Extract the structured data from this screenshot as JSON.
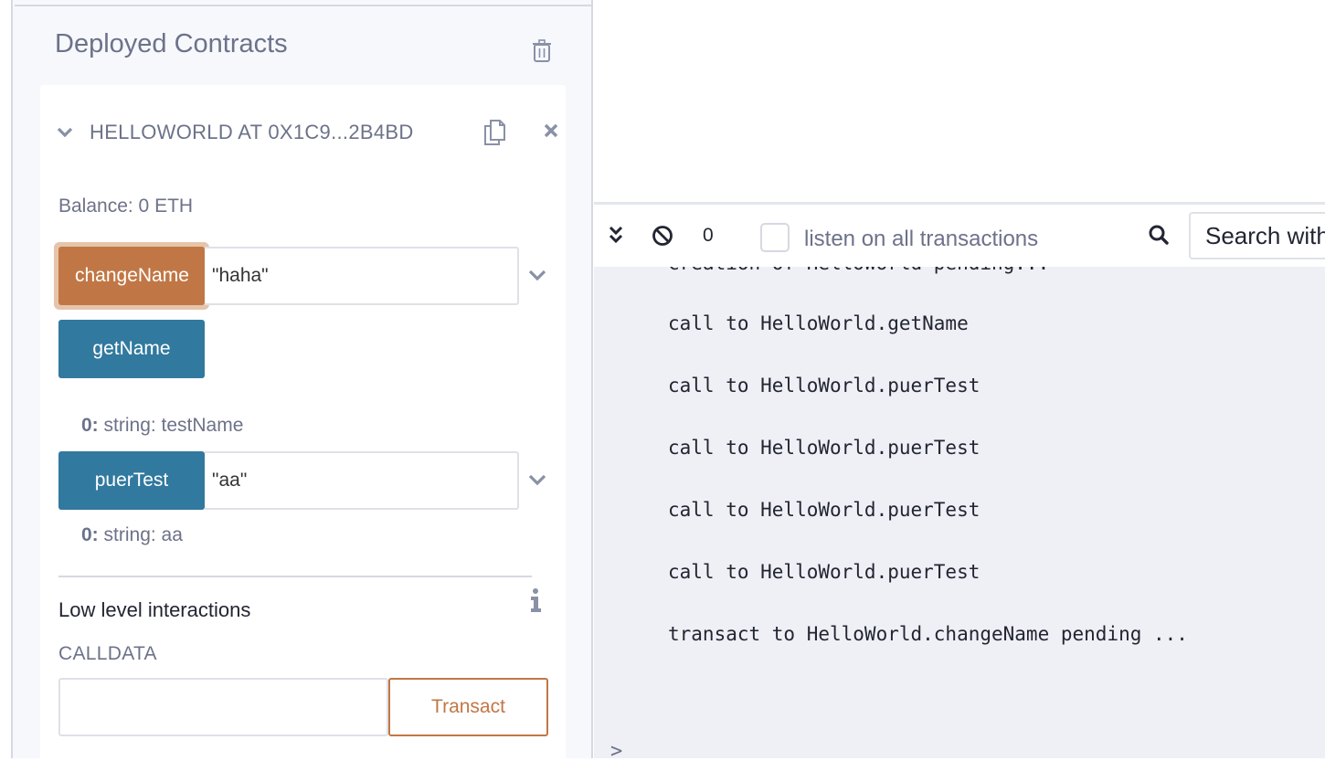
{
  "deployed": {
    "title": "Deployed Contracts",
    "contract": {
      "title": "HELLOWORLD AT 0X1C9...2B4BD",
      "balance": "Balance: 0 ETH",
      "functions": [
        {
          "label": "changeName",
          "kind": "transact",
          "input_value": "\"haha\"",
          "focused": true
        },
        {
          "label": "getName",
          "kind": "call"
        },
        {
          "label": "puerTest",
          "kind": "call",
          "input_value": "\"aa\""
        }
      ],
      "results": [
        {
          "index": "0:",
          "text": " string: testName"
        },
        {
          "index": "0:",
          "text": " string: aa"
        }
      ]
    },
    "low_level": {
      "title": "Low level interactions",
      "calldata_label": "CALLDATA",
      "calldata_value": "",
      "transact_label": "Transact"
    }
  },
  "terminal": {
    "pending_count": "0",
    "listen_label": "listen on all transactions",
    "listen_checked": false,
    "search_placeholder": "Search with transaction hash or address",
    "partial_line": "creation of HelloWorld pending...",
    "logs": [
      "call to HelloWorld.getName",
      "call to HelloWorld.puerTest",
      "call to HelloWorld.puerTest",
      "call to HelloWorld.puerTest",
      "call to HelloWorld.puerTest",
      "transact to HelloWorld.changeName pending ..."
    ],
    "prompt": ">"
  },
  "colors": {
    "transact_orange": "#c17745",
    "call_blue": "#31799f",
    "muted_text": "#6c7289",
    "terminal_bg": "#eef0f5"
  }
}
